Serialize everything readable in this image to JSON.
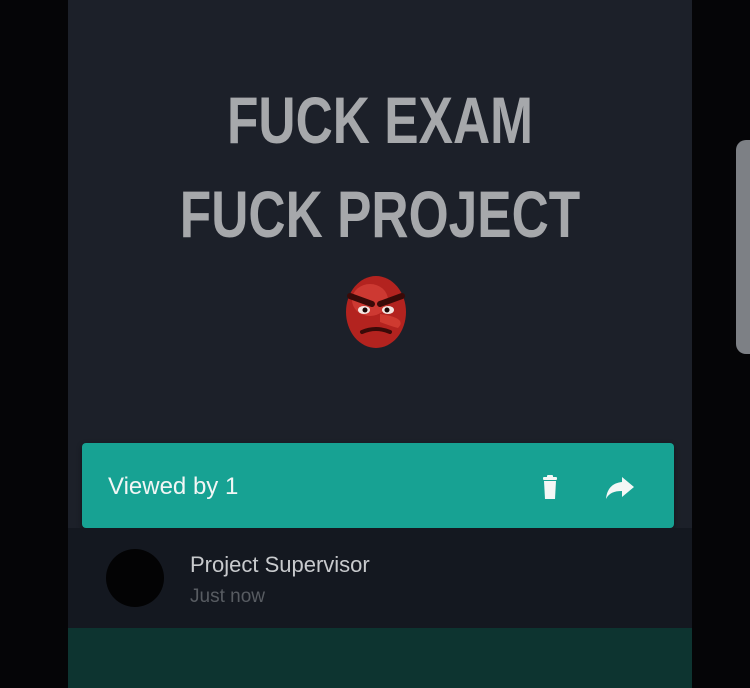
{
  "status": {
    "line1": "FUCK EXAM",
    "line2": "FUCK PROJECT",
    "emoji_icon": "angry-red-face-icon"
  },
  "viewed_bar": {
    "label": "Viewed by 1",
    "accent": "#17a293"
  },
  "viewers": [
    {
      "name": "Project Supervisor",
      "time": "Just now"
    }
  ]
}
